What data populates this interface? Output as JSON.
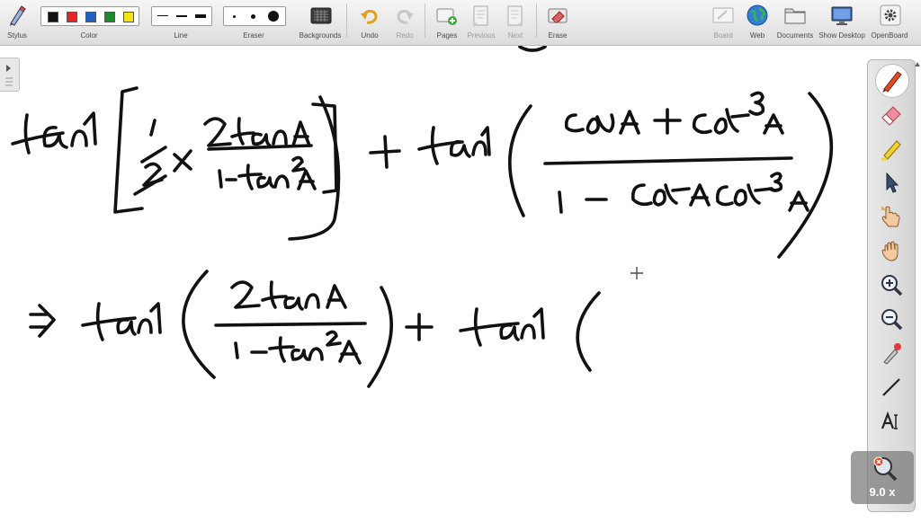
{
  "toolbar": {
    "stylus_label": "Stylus",
    "color_label": "Color",
    "line_label": "Line",
    "eraser_label": "Eraser",
    "backgrounds_label": "Backgrounds",
    "undo_label": "Undo",
    "redo_label": "Redo",
    "pages_label": "Pages",
    "previous_label": "Previous",
    "next_label": "Next",
    "erase_label": "Erase",
    "board_label": "Board",
    "web_label": "Web",
    "documents_label": "Documents",
    "show_desktop_label": "Show Desktop",
    "openboard_label": "OpenBoard"
  },
  "colors": {
    "palette": [
      "#111111",
      "#e52424",
      "#1f5fbf",
      "#1a8a2a",
      "#f5e21a"
    ],
    "ink": "#111111",
    "accent": "#e24a26"
  },
  "sidebar_tools": [
    "pen-icon",
    "eraser-icon",
    "highlighter-icon",
    "selector-icon",
    "interact-hand-icon",
    "pan-hand-icon",
    "zoom-in-icon",
    "zoom-out-icon",
    "laser-pointer-icon",
    "line-icon",
    "text-icon"
  ],
  "magnifier": {
    "zoom_label": "9.0 x"
  }
}
